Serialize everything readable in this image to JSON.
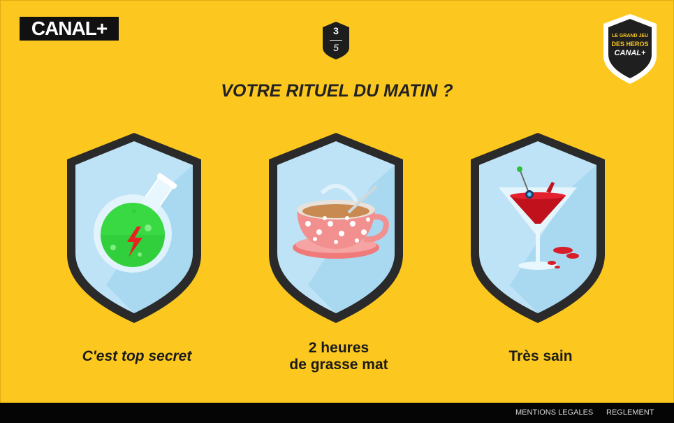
{
  "header": {
    "logo_text": "CANAL+",
    "step_current": "3",
    "step_total": "5",
    "badge_line1": "LE GRAND JEU",
    "badge_line2": "DES HEROS",
    "badge_line3": "CANAL+"
  },
  "question": "VOTRE RITUEL DU MATIN ?",
  "answers": [
    {
      "label": "C'est top secret",
      "icon": "potion-flask-icon"
    },
    {
      "label_line1": "2 heures",
      "label_line2": "de grasse mat",
      "icon": "teacup-icon"
    },
    {
      "label": "Très sain",
      "icon": "cocktail-glass-icon"
    }
  ],
  "footer": {
    "mentions": "MENTIONS LEGALES",
    "reglement": "REGLEMENT"
  },
  "colors": {
    "background": "#fcc81f",
    "shield_border": "#2a2a2a",
    "shield_fill": "#bfe3f6",
    "footer": "#050505"
  }
}
